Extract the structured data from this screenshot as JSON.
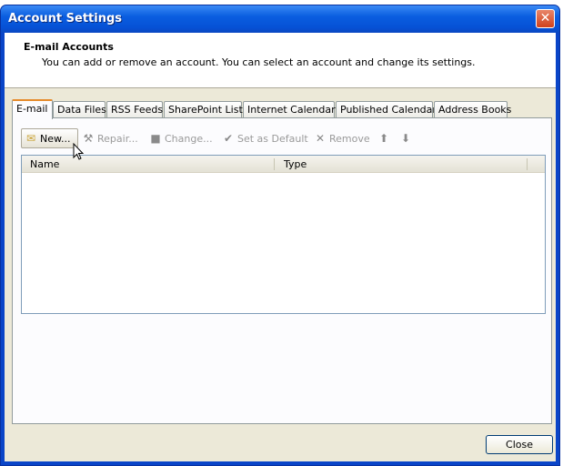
{
  "window": {
    "title": "Account Settings",
    "close_icon": "close-icon"
  },
  "header": {
    "title": "E-mail Accounts",
    "description": "You can add or remove an account. You can select an account and change its settings."
  },
  "tabs": [
    {
      "label": "E-mail"
    },
    {
      "label": "Data Files"
    },
    {
      "label": "RSS Feeds"
    },
    {
      "label": "SharePoint Lists"
    },
    {
      "label": "Internet Calendars"
    },
    {
      "label": "Published Calendars"
    },
    {
      "label": "Address Books"
    }
  ],
  "toolbar": {
    "new": "New...",
    "repair": "Repair...",
    "change": "Change...",
    "set_default": "Set as Default",
    "remove": "Remove"
  },
  "list": {
    "columns": [
      "Name",
      "Type"
    ],
    "rows": []
  },
  "footer": {
    "close": "Close"
  }
}
